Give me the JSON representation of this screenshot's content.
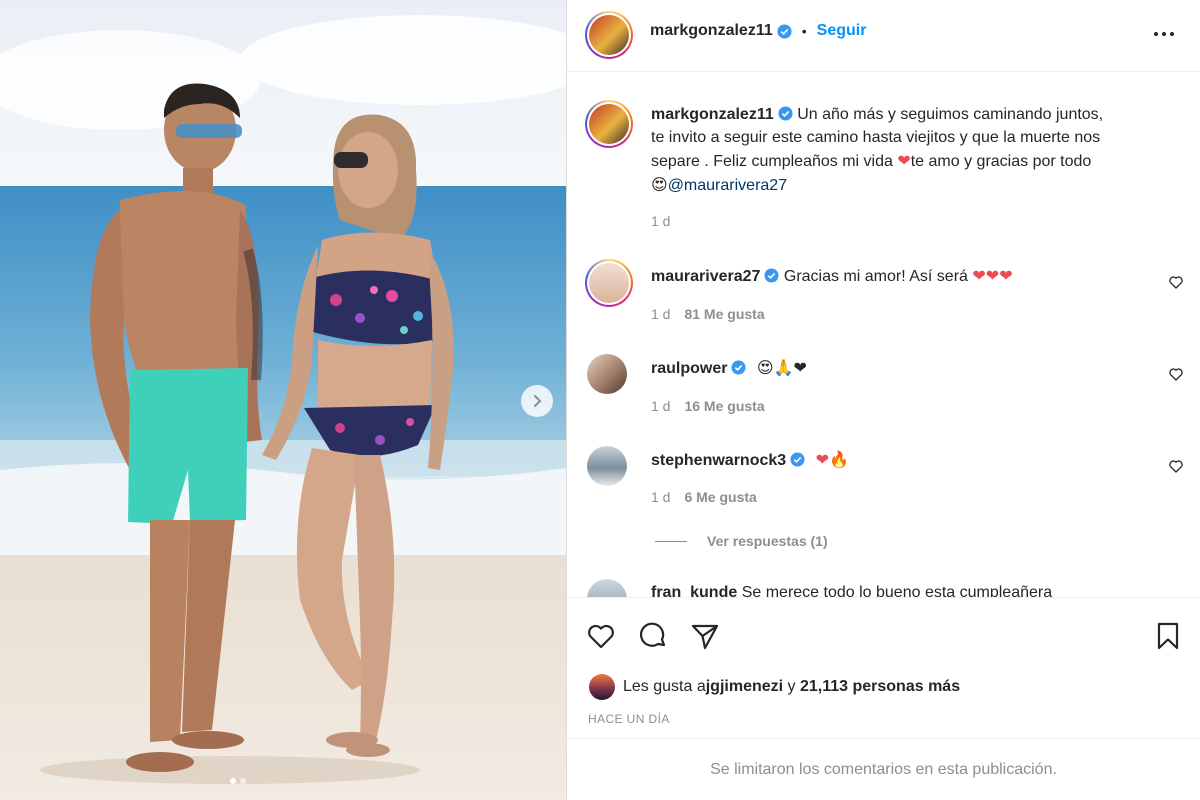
{
  "post": {
    "username": "markgonzalez11",
    "separator": "•",
    "follow_label": "Seguir",
    "more_icon": "more-horizontal-icon"
  },
  "caption": {
    "username": "markgonzalez11",
    "line1": "Un año más y seguimos caminando juntos,",
    "line2": "te invito a seguir este camino hasta viejitos y que la muerte nos",
    "line3_a": "separe . Feliz cumpleaños mi vida ",
    "line3_b": "te amo y gracias por todo",
    "mention": "@maurarivera27",
    "time": "1 d"
  },
  "comments": [
    {
      "username": "maurarivera27",
      "text": "Gracias mi amor! Así será ",
      "emoji": "❤❤❤",
      "time": "1 d",
      "likes": "81 Me gusta"
    },
    {
      "username": "raulpower",
      "text": "",
      "emoji": "😍🙏❤",
      "time": "1 d",
      "likes": "16 Me gusta"
    },
    {
      "username": "stephenwarnock3",
      "text": "",
      "emoji": "❤🔥",
      "time": "1 d",
      "likes": "6 Me gusta"
    },
    {
      "username": "fran_kunde",
      "text": "Se merece todo lo bueno esta cumpleañera"
    }
  ],
  "view_replies": "Ver respuestas (1)",
  "likes": {
    "prefix": "Les gusta a ",
    "user": "jgjimenezi",
    "middle": " y ",
    "count": "21,113 personas más"
  },
  "time_ago": "HACE UN DÍA",
  "comments_limited": "Se limitaron los comentarios en esta publicación.",
  "colors": {
    "accent": "#0095f6",
    "mention": "#00376b",
    "muted": "#8e8e8e",
    "verified": "#3897f0",
    "heart": "#ed4956"
  }
}
